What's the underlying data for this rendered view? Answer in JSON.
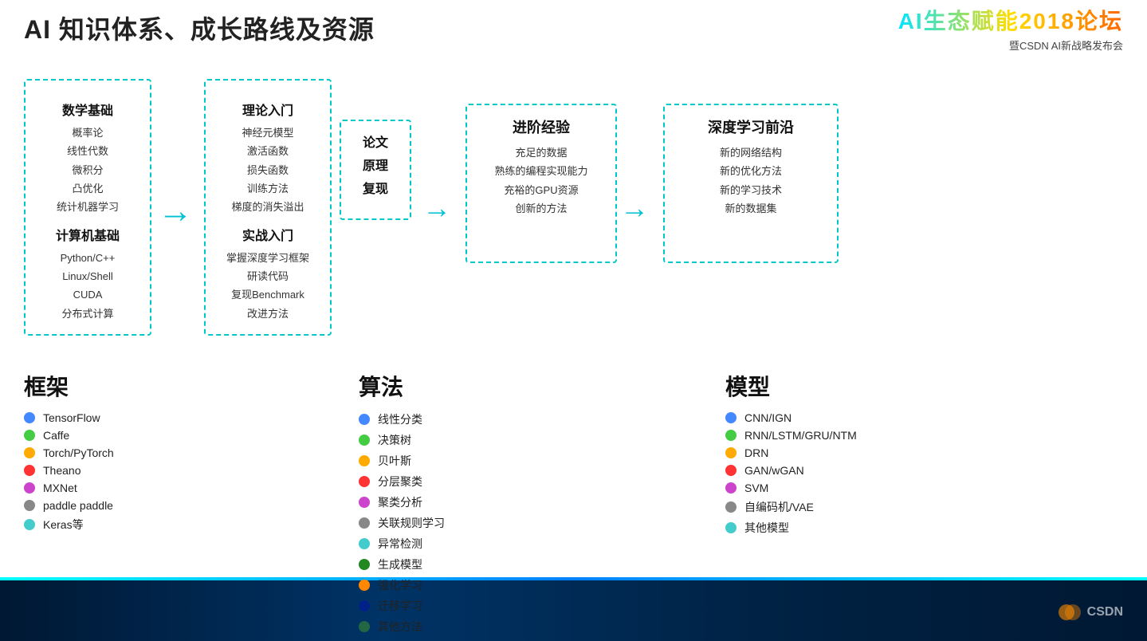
{
  "header": {
    "title": "AI 知识体系、成长路线及资源",
    "logo_main": "AI生态赋能2018论坛",
    "logo_sub": "暨CSDN AI新战略发布会"
  },
  "flow": {
    "math_box": {
      "section1_title": "数学基础",
      "section1_items": [
        "概率论",
        "线性代数",
        "微积分",
        "凸优化",
        "统计机器学习"
      ],
      "section2_title": "计算机基础",
      "section2_items": [
        "Python/C++",
        "Linux/Shell",
        "CUDA",
        "分布式计算"
      ]
    },
    "theory_box": {
      "section1_title": "理论入门",
      "section1_items": [
        "神经元模型",
        "激活函数",
        "损失函数",
        "训练方法",
        "梯度的消失溢出"
      ],
      "section2_title": "实战入门",
      "section2_items": [
        "掌握深度学习框架",
        "研读代码",
        "复现Benchmark",
        "改进方法"
      ]
    },
    "paper_box": {
      "title": "论文\n原理\n复现"
    },
    "adv_box": {
      "title": "进阶经验",
      "items": [
        "充足的数据",
        "熟练的编程实现能力",
        "充裕的GPU资源",
        "创新的方法"
      ]
    },
    "deep_box": {
      "title": "深度学习前沿",
      "items": [
        "新的网络结构",
        "新的优化方法",
        "新的学习技术",
        "新的数据集"
      ]
    }
  },
  "framework": {
    "title": "框架",
    "items": [
      {
        "color": "#4488ff",
        "label": "TensorFlow"
      },
      {
        "color": "#44cc44",
        "label": "Caffe"
      },
      {
        "color": "#ffaa00",
        "label": "Torch/PyTorch"
      },
      {
        "color": "#ff3333",
        "label": "Theano"
      },
      {
        "color": "#cc44cc",
        "label": "MXNet"
      },
      {
        "color": "#888888",
        "label": "paddle paddle"
      },
      {
        "color": "#44cccc",
        "label": "Keras等"
      }
    ]
  },
  "algorithm": {
    "title": "算法",
    "items": [
      {
        "color": "#4488ff",
        "label": "线性分类"
      },
      {
        "color": "#44cc44",
        "label": "决策树"
      },
      {
        "color": "#ffaa00",
        "label": "贝叶斯"
      },
      {
        "color": "#ff3333",
        "label": "分层聚类"
      },
      {
        "color": "#cc44cc",
        "label": "聚类分析"
      },
      {
        "color": "#888888",
        "label": "关联规则学习"
      },
      {
        "color": "#44cccc",
        "label": "异常检测"
      },
      {
        "color": "#228822",
        "label": "生成模型"
      },
      {
        "color": "#ff8800",
        "label": "强化学习"
      },
      {
        "color": "#002288",
        "label": "迁移学习"
      },
      {
        "color": "#226644",
        "label": "其他方法"
      }
    ]
  },
  "model": {
    "title": "模型",
    "items": [
      {
        "color": "#4488ff",
        "label": "CNN/IGN"
      },
      {
        "color": "#44cc44",
        "label": "RNN/LSTM/GRU/NTM"
      },
      {
        "color": "#ffaa00",
        "label": "DRN"
      },
      {
        "color": "#ff3333",
        "label": "GAN/wGAN"
      },
      {
        "color": "#cc44cc",
        "label": "SVM"
      },
      {
        "color": "#888888",
        "label": "自编码机/VAE"
      },
      {
        "color": "#44cccc",
        "label": "其他模型"
      }
    ]
  },
  "watermark": "CSDN"
}
